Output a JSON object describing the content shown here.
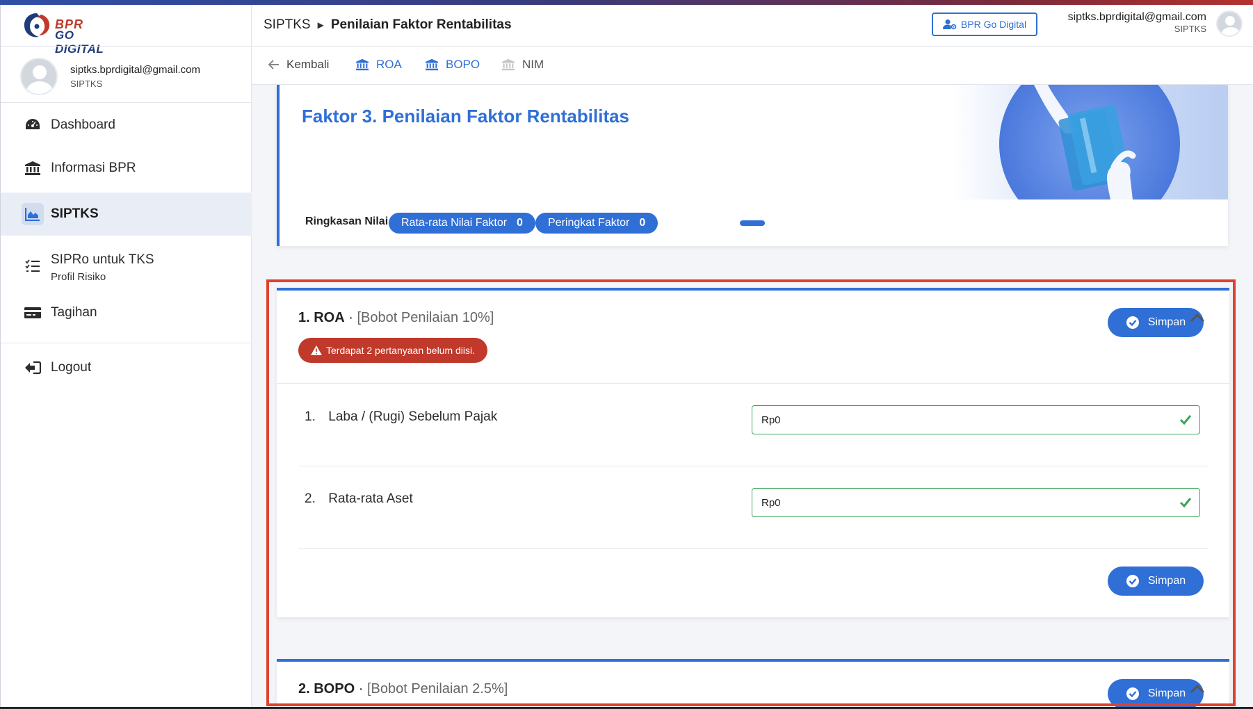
{
  "app": {
    "logo_line1": "BPR",
    "logo_line2": "GO DIGITAL"
  },
  "user": {
    "email": "siptks.bprdigital@gmail.com",
    "role": "SIPTKS"
  },
  "sidebar": {
    "items": [
      {
        "label": "Dashboard",
        "icon": "dashboard-icon"
      },
      {
        "label": "Informasi BPR",
        "icon": "bank-icon"
      },
      {
        "label": "SIPTKS",
        "icon": "chart-area-icon",
        "active": true
      },
      {
        "label": "SIPRo untuk TKS",
        "sub": "Profil Risiko",
        "icon": "list-check-icon"
      },
      {
        "label": "Tagihan",
        "icon": "credit-card-icon"
      },
      {
        "label": "Logout",
        "icon": "logout-icon"
      }
    ]
  },
  "header": {
    "breadcrumb_root": "SIPTKS",
    "breadcrumb_current": "Penilaian Faktor Rentabilitas",
    "go_digital_button": "BPR Go Digital"
  },
  "tabs": {
    "back": "Kembali",
    "items": [
      {
        "label": "ROA",
        "state": "active"
      },
      {
        "label": "BOPO",
        "state": "active"
      },
      {
        "label": "NIM",
        "state": "inactive"
      }
    ]
  },
  "hero": {
    "title": "Faktor 3. Penilaian Faktor Rentabilitas",
    "summary_label": "Ringkasan Nilai",
    "avg_label": "Rata-rata Nilai Faktor",
    "avg_value": "0",
    "rank_label": "Peringkat Faktor",
    "rank_value": "0"
  },
  "sections": [
    {
      "number": "1. ROA",
      "separator": "·",
      "weight": "[Bobot Penilaian 10%]",
      "warning": "Terdapat 2 pertanyaan belum diisi.",
      "save_label": "Simpan",
      "questions": [
        {
          "num": "1.",
          "label": "Laba / (Rugi) Sebelum Pajak",
          "value": "Rp0"
        },
        {
          "num": "2.",
          "label": "Rata-rata Aset",
          "value": "Rp0"
        }
      ]
    },
    {
      "number": "2. BOPO",
      "separator": "·",
      "weight": "[Bobot Penilaian 2.5%]",
      "save_label": "Simpan"
    }
  ],
  "colors": {
    "primary": "#2f6fd6",
    "danger": "#c0392b",
    "success": "#3aa55a",
    "highlight": "#e0412c"
  }
}
